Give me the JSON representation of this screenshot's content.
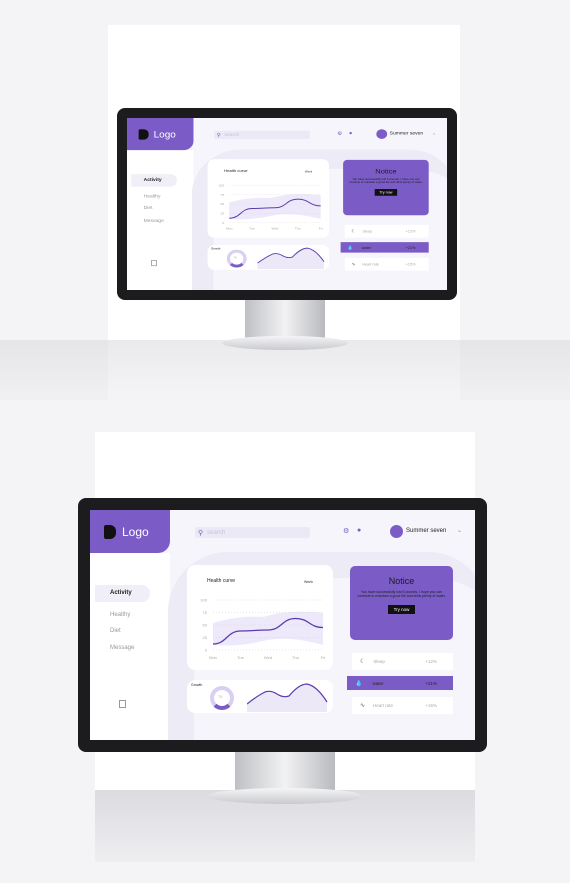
{
  "brand": {
    "logo_text": "Logo",
    "accent": "#7b5cc6"
  },
  "header": {
    "search_placeholder": "search",
    "user_name": "Summer seven"
  },
  "sidebar": {
    "items": [
      {
        "label": "Activity",
        "active": true
      },
      {
        "label": "Healthy"
      },
      {
        "label": "Diet"
      },
      {
        "label": "Message"
      }
    ]
  },
  "health": {
    "title": "Health curve",
    "period": "Week"
  },
  "growth": {
    "title": "Growth",
    "value": "78"
  },
  "notice": {
    "title": "Notice",
    "text": "You have successfully lost 6 pounds. I hope you can continue to maintain a good life and drink plenty of water.",
    "button": "Try now"
  },
  "stats": [
    {
      "label": "Sleep",
      "value": "+12%",
      "icon": "moon-icon"
    },
    {
      "label": "water",
      "value": "+21%",
      "icon": "drop-icon",
      "highlighted": true
    },
    {
      "label": "Heart rate",
      "value": "+15%",
      "icon": "pulse-icon"
    }
  ],
  "chart_data": {
    "type": "line",
    "categories": [
      "Mon",
      "Tue",
      "Wed",
      "Thu",
      "Fri"
    ],
    "values": [
      12,
      38,
      40,
      63,
      45
    ],
    "yticks": [
      "100",
      "75",
      "50",
      "25",
      "0"
    ],
    "ylim": [
      0,
      100
    ],
    "grid": true
  }
}
